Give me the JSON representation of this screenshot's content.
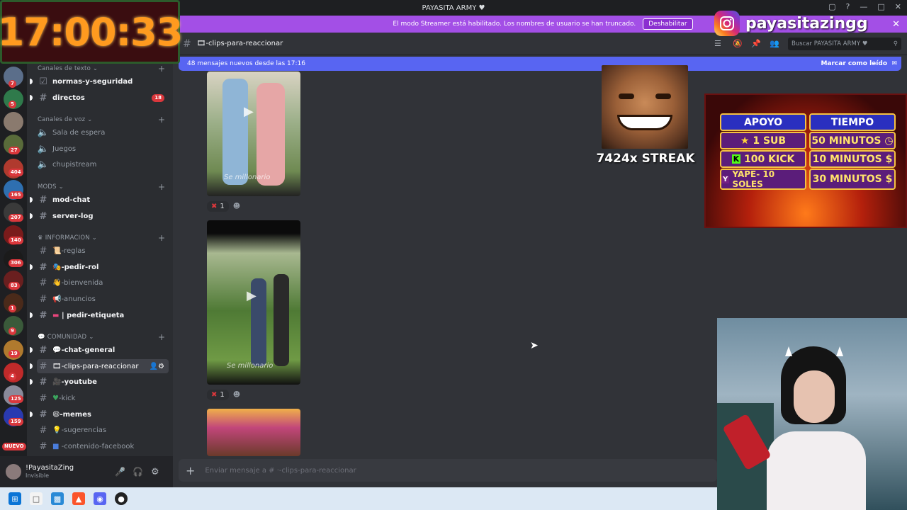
{
  "window": {
    "title": "PAYASITA ARMY ♥"
  },
  "streamer_banner": {
    "text": "El modo Streamer está habilitado. Los nombres de usuario se han truncado.",
    "button": "Deshabilitar"
  },
  "clock": {
    "time": "17:00:33"
  },
  "instagram": {
    "handle": "payasitazingg"
  },
  "server_rail": {
    "badges": [
      "7",
      "5",
      "27",
      "404",
      "165",
      "207",
      "140",
      "306",
      "83",
      "1",
      "9",
      "19",
      "4",
      "125",
      "159",
      "NUEVO"
    ]
  },
  "categories": {
    "text": "Canales de texto",
    "voice": "Canales de voz",
    "mods": "MODS",
    "info": "INFORMACION",
    "community": "COMUNIDAD"
  },
  "channels": {
    "normas": "normas-y-seguridad",
    "directos": "directos",
    "directos_count": "18",
    "sala": "Sala de espera",
    "juegos": "Juegos",
    "chupistream": "chupistream",
    "modchat": "mod-chat",
    "serverlog": "server-log",
    "reglas": "-reglas",
    "pedirrol": "-pedir-rol",
    "bienvenida": "-bienvenida",
    "anuncios": "-anuncios",
    "etiqueta": "| pedir-etiqueta",
    "chatgeneral": "-chat-general",
    "clips": "-clips-para-reaccionar",
    "youtube": "-youtube",
    "kick": "-kick",
    "memes": "-memes",
    "sugerencias": "-sugerencias",
    "facebook": "-contenido-facebook"
  },
  "user": {
    "name": "!PayasitaZing",
    "status": "Invisible"
  },
  "header": {
    "channel": "-clips-para-reaccionar",
    "search_placeholder": "Buscar PAYASITA ARMY ♥"
  },
  "new_messages": {
    "text": "48 mensajes nuevos desde las 17:16",
    "mark_read": "Marcar como leído"
  },
  "clips": [
    {
      "watermark": "Se millonario",
      "reaction_count": "1"
    },
    {
      "watermark": "Se millonario",
      "reaction_count": "1"
    }
  ],
  "composer": {
    "placeholder": "Enviar mensaje a # ·-clips-para-reaccionar"
  },
  "overlay": {
    "streak": "7424x STREAK",
    "panel": {
      "header_a": "APOYO",
      "header_b": "TIEMPO",
      "rows": [
        {
          "a": "1 SUB",
          "b": "50 MINUTOS"
        },
        {
          "a": "100 KICK",
          "b": "10 MINUTOS"
        },
        {
          "a": "YAPE- 10 SOLES",
          "b": "30 MINUTOS"
        }
      ]
    }
  }
}
